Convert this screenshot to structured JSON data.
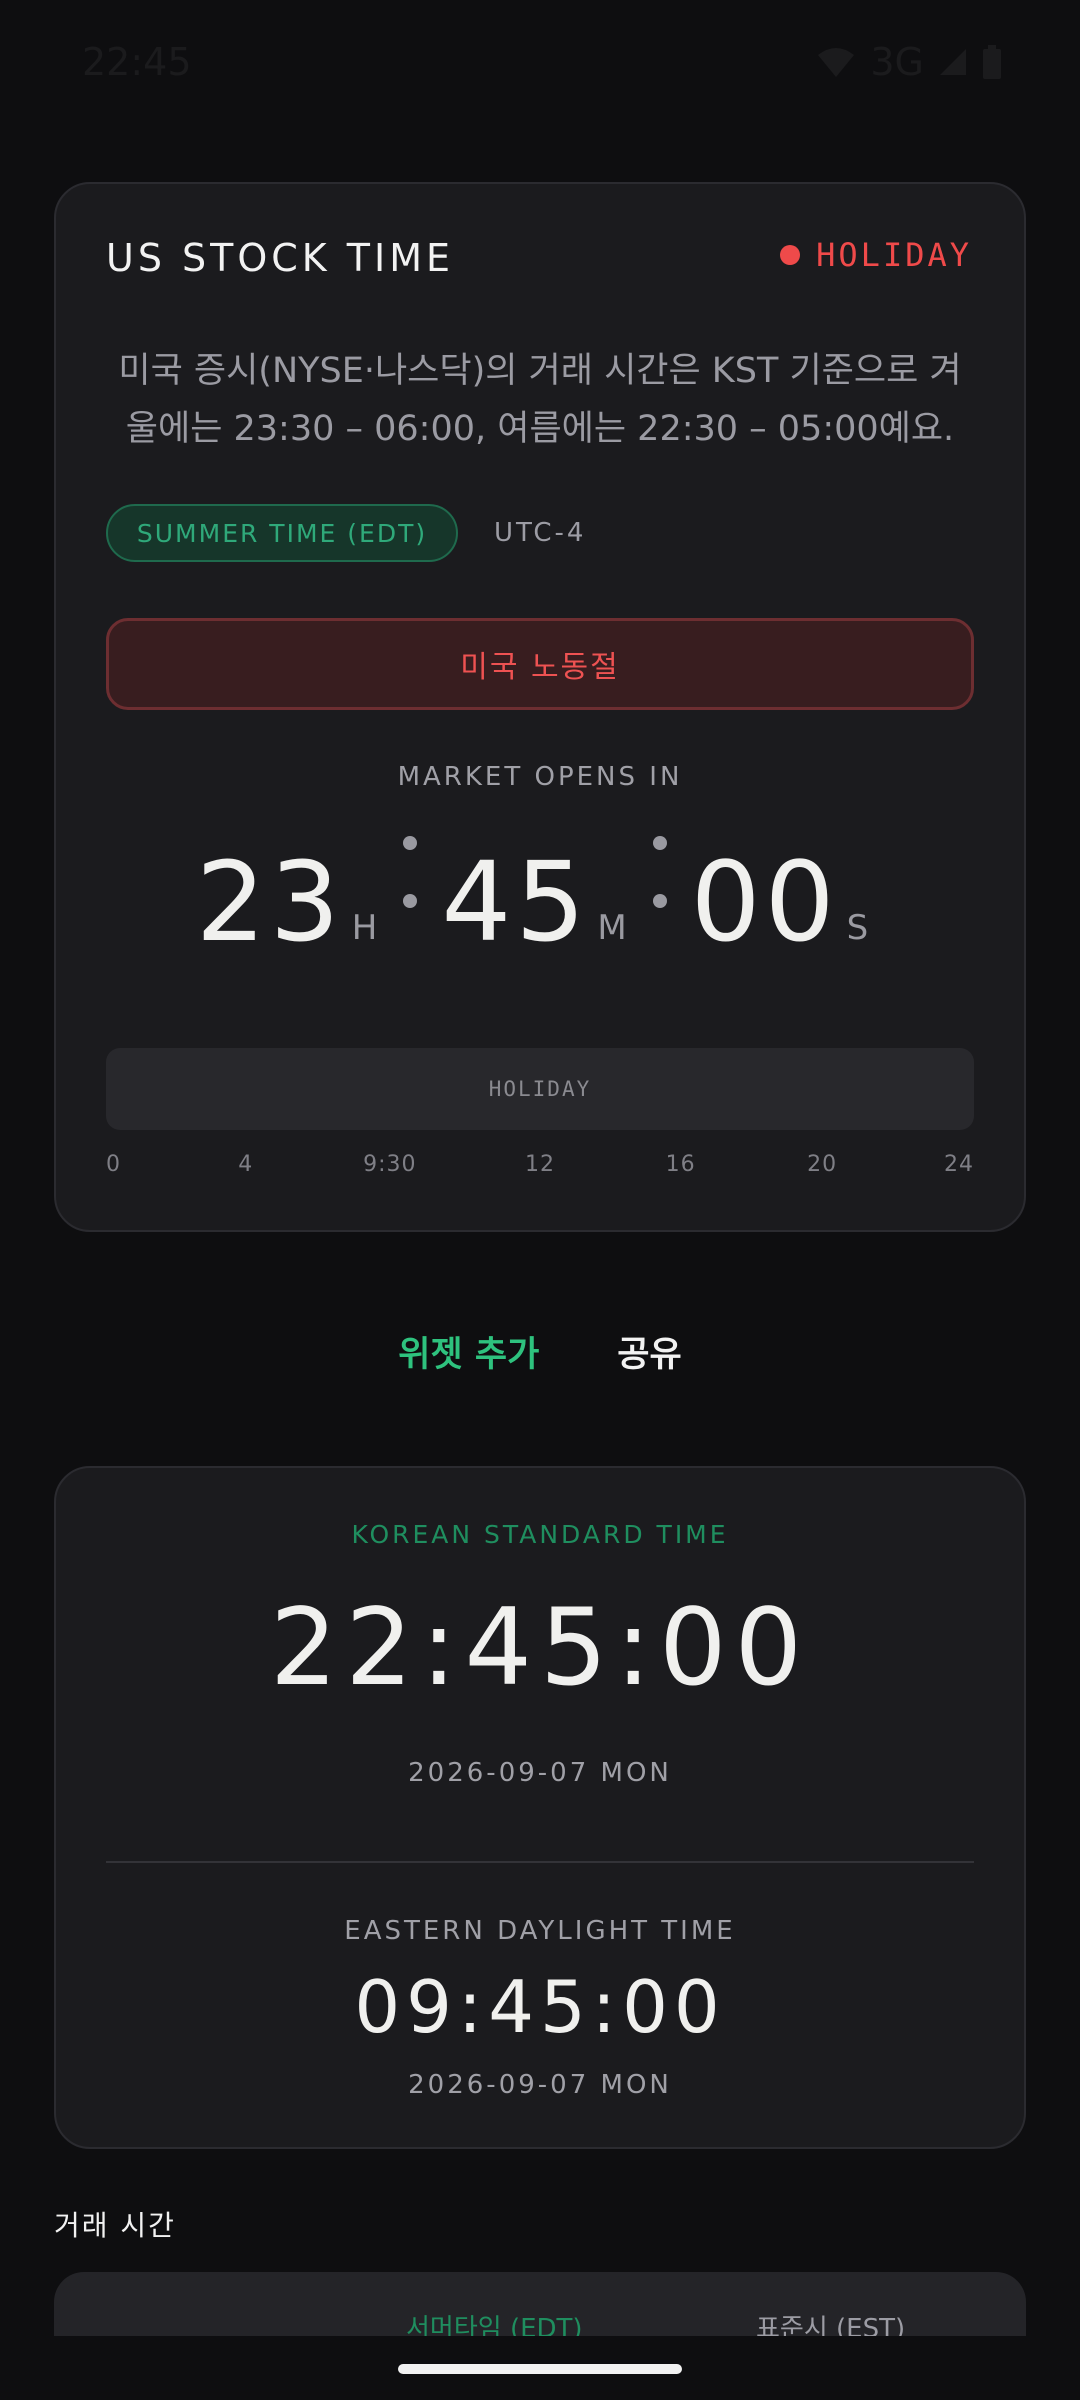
{
  "status_bar": {
    "time": "22:45",
    "network": "3G"
  },
  "card": {
    "title": "US STOCK TIME",
    "status_label": "HOLIDAY",
    "description": "미국 증시(NYSE·나스닥)의 거래 시간은 KST 기준으로 겨울에는 23:30 – 06:00, 여름에는 22:30 – 05:00예요.",
    "dst_pill": "SUMMER TIME (EDT)",
    "utc_offset": "UTC-4",
    "holiday_name": "미국 노동절",
    "countdown_label": "MARKET OPENS IN",
    "countdown": {
      "h": "23",
      "h_unit": "H",
      "m": "45",
      "m_unit": "M",
      "s": "00",
      "s_unit": "S"
    },
    "timeline_label": "HOLIDAY",
    "timeline_ticks": [
      "0",
      "4",
      "9:30",
      "12",
      "16",
      "20",
      "24"
    ]
  },
  "actions": {
    "add_widget": "위젯 추가",
    "share": "공유"
  },
  "clock_card": {
    "kst_label": "KOREAN STANDARD TIME",
    "kst_time": "22:45:00",
    "kst_date": "2026-09-07 MON",
    "edt_label": "EASTERN DAYLIGHT TIME",
    "edt_time": "09:45:00",
    "edt_date": "2026-09-07 MON"
  },
  "trading_hours": {
    "title": "거래 시간",
    "columns": [
      "서머타임 (EDT)",
      "표준시 (EST)"
    ]
  },
  "colors": {
    "accent_green": "#2ec27e",
    "holiday_red": "#ef4a4a",
    "background": "#0e0e10",
    "card": "#1b1b1e"
  }
}
